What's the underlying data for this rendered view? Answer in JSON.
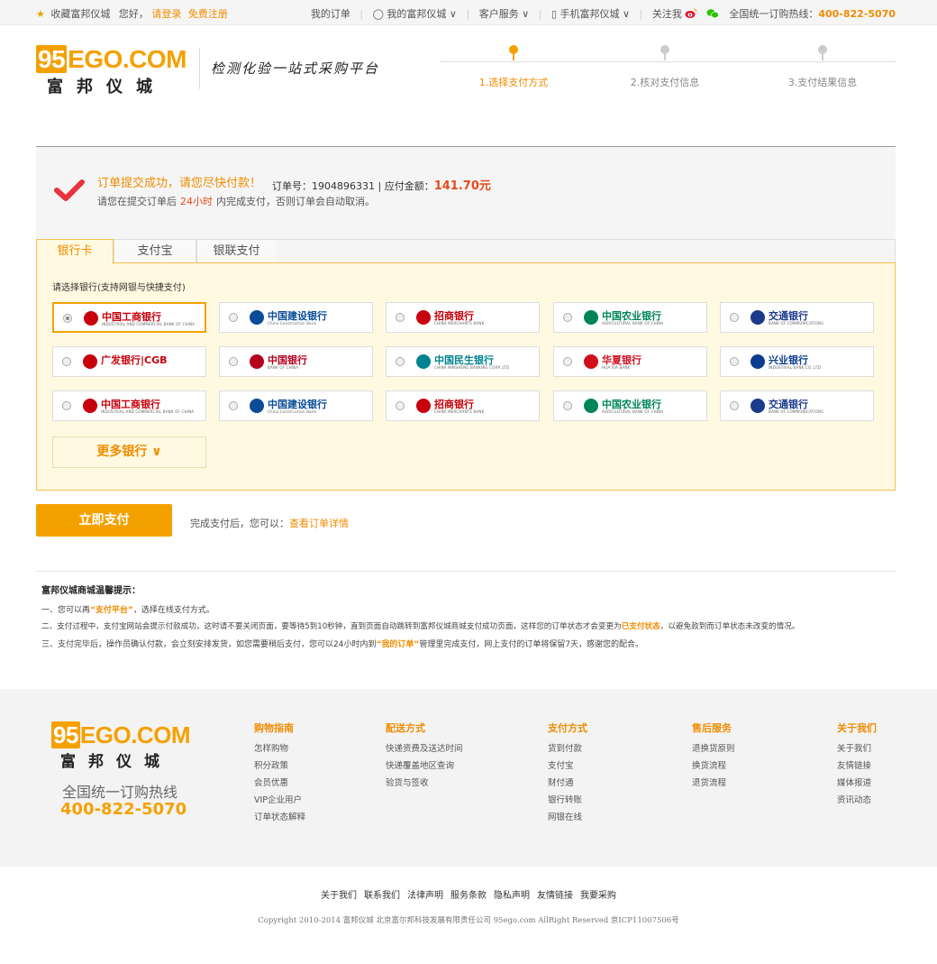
{
  "topbar": {
    "favorite": "收藏富邦仪城",
    "greeting": "您好，",
    "login": "请登录",
    "register": "免费注册",
    "my_orders": "我的订单",
    "my_account": "我的富邦仪城",
    "customer_service": "客户服务",
    "mobile": "手机富邦仪城",
    "follow": "关注我",
    "hotline_label": "全国统一订购热线：",
    "hotline": "400-822-5070"
  },
  "header": {
    "brand_num": "95",
    "brand": "EGO.COM",
    "brand_cn": "富邦仪城",
    "slogan": "检测化验一站式采购平台"
  },
  "steps": [
    {
      "label": "1.选择支付方式",
      "active": true
    },
    {
      "label": "2.核对支付信息",
      "active": false
    },
    {
      "label": "3.支付结果信息",
      "active": false
    }
  ],
  "success": {
    "title": "订单提交成功，请您尽快付款！",
    "order_label": "订单号：",
    "order_no": "1904896331",
    "amount_label": " | 应付金额：",
    "amount": "141.70元",
    "desc_pre": "请您在提交订单后",
    "desc_hours": "24小时",
    "desc_post": "内完成支付，否则订单会自动取消。"
  },
  "tabs": [
    "银行卡",
    "支付宝",
    "银联支付"
  ],
  "bank_hint": "请选择银行(支持网银与快捷支付)",
  "banks": [
    {
      "name": "中国工商银行",
      "sub": "INDUSTRIAL AND COMMERCIAL BANK OF CHINA",
      "color": "#c7000b"
    },
    {
      "name": "中国建设银行",
      "sub": "China Construction Bank",
      "color": "#0a4c97"
    },
    {
      "name": "招商银行",
      "sub": "CHINA MERCHANTS BANK",
      "color": "#c7000b"
    },
    {
      "name": "中国农业银行",
      "sub": "AGRICULTURAL BANK OF CHINA",
      "color": "#00845a"
    },
    {
      "name": "交通银行",
      "sub": "BANK OF COMMUNICATIONS",
      "color": "#1b3a8c"
    },
    {
      "name": "广发银行|CGB",
      "sub": "",
      "color": "#c7000b"
    },
    {
      "name": "中国银行",
      "sub": "BANK OF CHINA",
      "color": "#b5001c"
    },
    {
      "name": "中国民生银行",
      "sub": "CHINA MINSHENG BANKING CORP.,LTD",
      "color": "#00838f"
    },
    {
      "name": "华夏银行",
      "sub": "HUA XIA BANK",
      "color": "#d0111b"
    },
    {
      "name": "兴业银行",
      "sub": "INDUSTRIAL BANK CO.,LTD",
      "color": "#0a3d8f"
    },
    {
      "name": "中国工商银行",
      "sub": "INDUSTRIAL AND COMMERCIAL BANK OF CHINA",
      "color": "#c7000b"
    },
    {
      "name": "中国建设银行",
      "sub": "China Construction Bank",
      "color": "#0a4c97"
    },
    {
      "name": "招商银行",
      "sub": "CHINA MERCHANTS BANK",
      "color": "#c7000b"
    },
    {
      "name": "中国农业银行",
      "sub": "AGRICULTURAL BANK OF CHINA",
      "color": "#00845a"
    },
    {
      "name": "交通银行",
      "sub": "BANK OF COMMUNICATIONS",
      "color": "#1b3a8c"
    }
  ],
  "more_banks": "更多银行 ∨",
  "pay": {
    "button": "立即支付",
    "after_text": "完成支付后，您可以：",
    "after_link": "查看订单详情"
  },
  "tips": {
    "title": "富邦仪城商城温馨提示：",
    "l1_pre": "一、您可以再",
    "l1_hl": "“支付平台”",
    "l1_post": "，选择在线支付方式。",
    "l2_pre": "二、支付过程中，支付宝网站会提示付款成功，这时请不要关闭页面，要等待5到10秒钟，直到页面自动跳转到富邦仪城商城支付成功页面，这样您的订单状态才会变更为",
    "l2_hl": "已支付状态",
    "l2_post": "，以避免款到而订单状态未改变的情况。",
    "l3_pre": "三、支付完毕后，操作员确认付款，会立刻安排发货，如您需要稍后支付，您可以24小时内到",
    "l3_hl": "“我的订单”",
    "l3_post": "管理里完成支付，网上支付的订单将保留7天，感谢您的配合。"
  },
  "footer": {
    "hotline_label": "全国统一订购热线",
    "hotline": "400-822-5070",
    "columns": [
      {
        "title": "购物指南",
        "items": [
          "怎样购物",
          "积分政策",
          "会员优惠",
          "VIP企业用户",
          "订单状态解释"
        ]
      },
      {
        "title": "配送方式",
        "items": [
          "快递资费及送达时间",
          "快递覆盖地区查询",
          "验货与签收"
        ]
      },
      {
        "title": "支付方式",
        "items": [
          "货到付款",
          "支付宝",
          "财付通",
          "银行转账",
          "网银在线"
        ]
      },
      {
        "title": "售后服务",
        "items": [
          "退换货原则",
          "换货流程",
          "退货流程"
        ]
      },
      {
        "title": "关于我们",
        "items": [
          "关于我们",
          "友情链接",
          "媒体报道",
          "资讯动态"
        ]
      }
    ],
    "links": [
      "关于我们",
      "联系我们",
      "法律声明",
      "服务条款",
      "隐私声明",
      "友情链接",
      "我要采购"
    ],
    "copyright": "Copyright 2010-2014 富邦仪城  北京富尔邦科技发展有限责任公司 95ego.com   AllRight Reserved 京ICP11007506号"
  },
  "colors": {
    "accent": "#f4a100",
    "link": "#f08c00",
    "price": "#e64a19"
  }
}
